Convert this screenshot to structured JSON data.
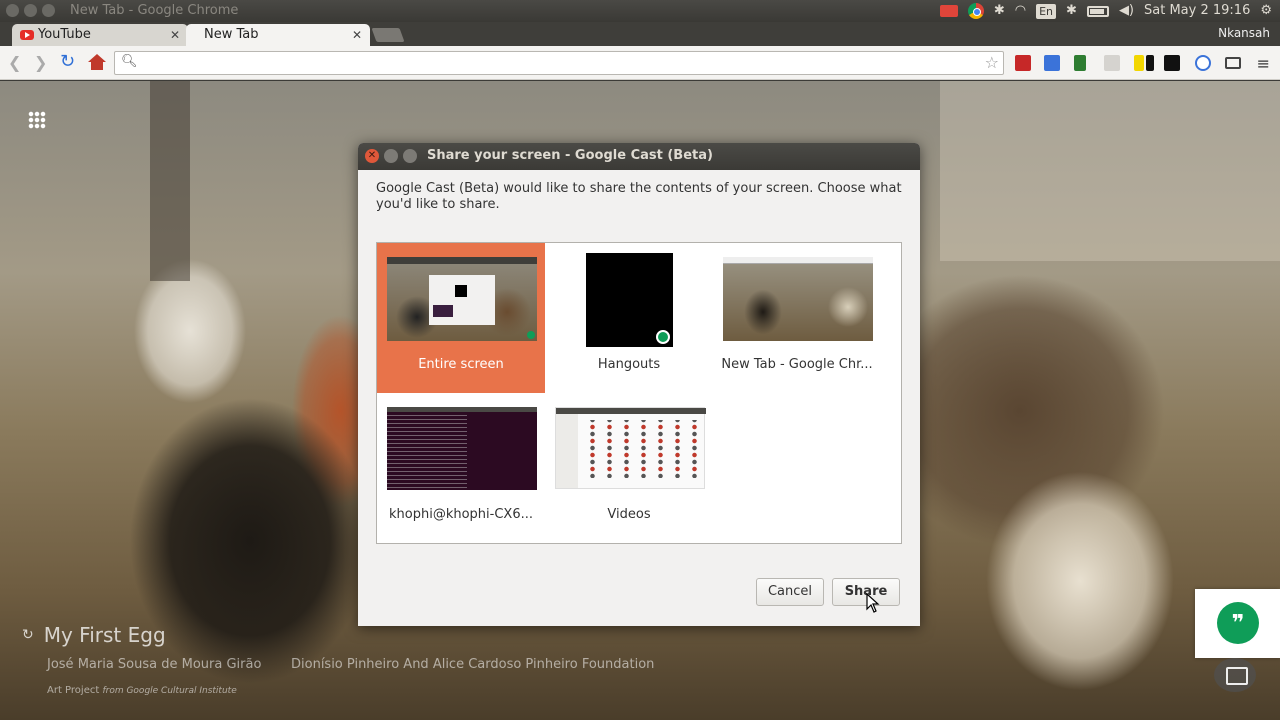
{
  "os_panel": {
    "window_title": "New Tab - Google Chrome",
    "keyboard_layout": "En",
    "datetime": "Sat May 2 19:16",
    "icons": [
      "record-icon",
      "chrome-icon",
      "bluetooth-icon",
      "wifi-icon",
      "keyboard-icon",
      "bluetooth-icon",
      "battery-icon",
      "volume-icon",
      "settings-gear-icon"
    ]
  },
  "browser": {
    "tabs": [
      {
        "label": "YouTube",
        "icon": "youtube-icon",
        "active": false
      },
      {
        "label": "New Tab",
        "active": true
      }
    ],
    "profile_name": "Nkansah",
    "omnibox_value": "",
    "extension_icons": [
      "red-square-ext-icon",
      "translate-ext-icon",
      "green-doc-ext-icon",
      "grey-ext-icon",
      "yellow-ext-icon",
      "black-ext-icon",
      "sync-ext-icon",
      "cast-icon"
    ]
  },
  "new_tab_page": {
    "artwork_title": "My First Egg",
    "artist": "José Maria Sousa de Moura Girão",
    "owner": "Dionísio Pinheiro And Alice Cardoso Pinheiro Foundation",
    "credit_prefix": "Art Project",
    "credit_suffix": "from Google Cultural Institute",
    "hangouts_glyph": "❞"
  },
  "dialog": {
    "title": "Share your screen - Google Cast (Beta)",
    "message": "Google Cast (Beta) would like to share the contents of your screen. Choose what you'd like to share.",
    "sources": [
      {
        "label": "Entire screen",
        "selected": true
      },
      {
        "label": "Hangouts",
        "selected": false
      },
      {
        "label": "New Tab - Google Chr...",
        "selected": false
      },
      {
        "label": "khophi@khophi-CX6...",
        "selected": false
      },
      {
        "label": "Videos",
        "selected": false
      }
    ],
    "cancel_label": "Cancel",
    "share_label": "Share",
    "selected_color": "#e8734a"
  }
}
